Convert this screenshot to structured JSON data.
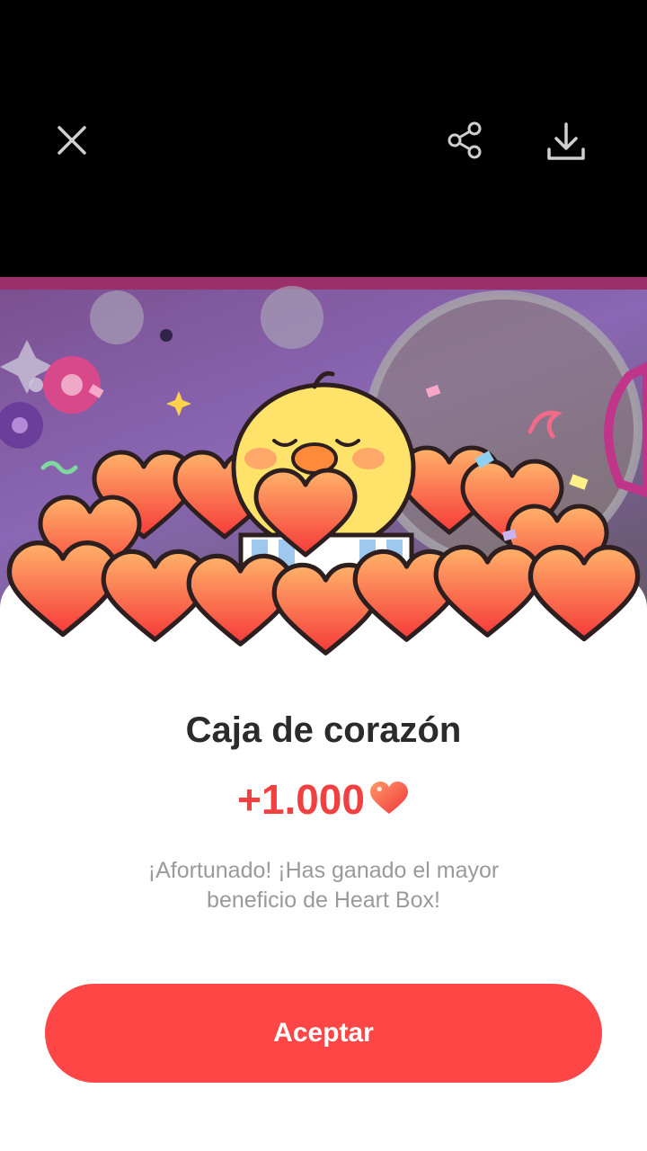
{
  "topbar": {
    "close_icon": "close-icon",
    "share_icon": "share-icon",
    "download_icon": "download-icon"
  },
  "dialog": {
    "title": "Caja de corazón",
    "reward_amount": "+1.000",
    "reward_icon": "heart-icon",
    "message": "¡Afortunado! ¡Has ganado el mayor beneficio de Heart Box!",
    "accept_label": "Aceptar"
  },
  "colors": {
    "accent": "#fe4646",
    "heart": "#ff6b4a",
    "title": "#2b2b2b",
    "message": "#9a9a9a"
  }
}
